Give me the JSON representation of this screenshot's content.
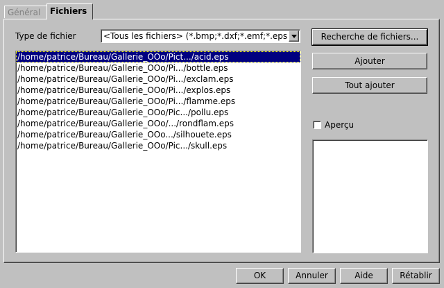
{
  "tabs": [
    {
      "label": "Général",
      "active": false
    },
    {
      "label": "Fichiers",
      "active": true
    }
  ],
  "file_type": {
    "label": "Type de fichier",
    "value": "<Tous les fichiers> (*.bmp;*.dxf;*.emf;*.eps;*.gif;*.jpg;*.jpeg;*.met;*.pbm;*.pcd;*.pct;*.pcx;*.pgm;*.png;*.ppm;*.psd;*.ras;*.sgf;*.sgv;*.svm;*.tga;*.tif;*.tiff;*.wmf;*.xbm;*.xpm)"
  },
  "files": [
    "/home/patrice/Bureau/Gallerie_OOo/Pict.../acid.eps",
    "/home/patrice/Bureau/Gallerie_OOo/Pi.../bottle.eps",
    "/home/patrice/Bureau/Gallerie_OOo/Pi.../exclam.eps",
    "/home/patrice/Bureau/Gallerie_OOo/Pi.../explos.eps",
    "/home/patrice/Bureau/Gallerie_OOo/Pi.../flamme.eps",
    "/home/patrice/Bureau/Gallerie_OOo/Pic.../pollu.eps",
    "/home/patrice/Bureau/Gallerie_OOo/.../rondflam.eps",
    "/home/patrice/Bureau/Gallerie_OOo.../silhouete.eps",
    "/home/patrice/Bureau/Gallerie_OOo/Pic.../skull.eps"
  ],
  "selected_index": 0,
  "buttons": {
    "search": "Recherche de fichiers...",
    "add": "Ajouter",
    "add_all": "Tout ajouter"
  },
  "preview": {
    "label": "Aperçu",
    "checked": false
  },
  "footer": {
    "ok": "OK",
    "cancel": "Annuler",
    "help": "Aide",
    "reset": "Rétablir"
  },
  "icons": {
    "dropdown": "triangle-down-icon"
  }
}
